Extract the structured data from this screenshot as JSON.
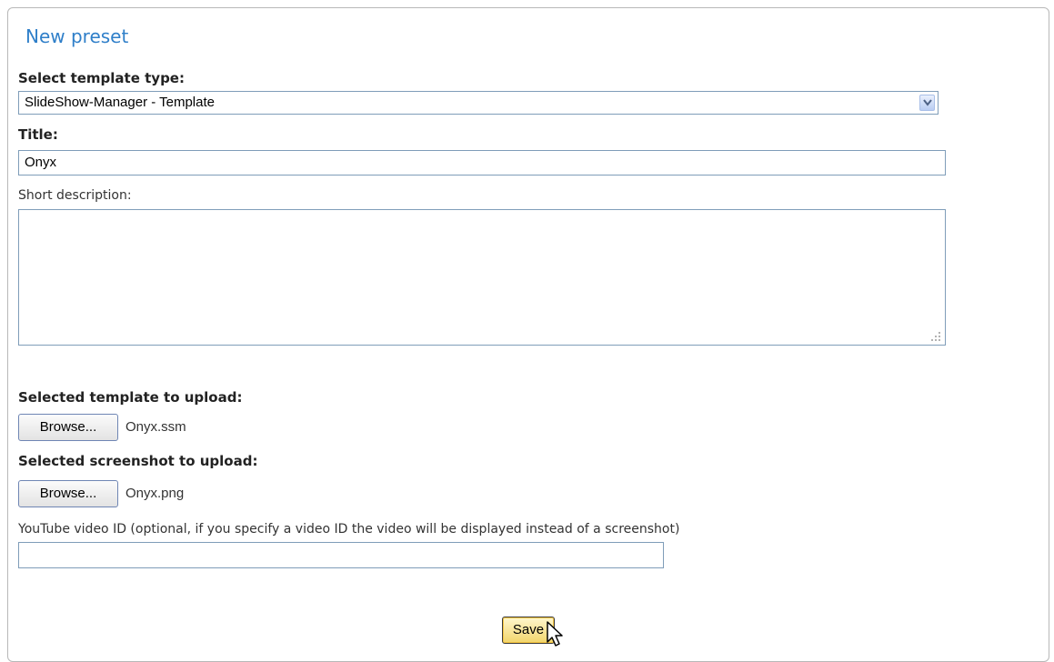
{
  "panel": {
    "heading": "New preset"
  },
  "template_type": {
    "label": "Select template type:",
    "selected": "SlideShow-Manager - Template"
  },
  "title_field": {
    "label": "Title:",
    "value": "Onyx"
  },
  "description_field": {
    "label": "Short description:",
    "value": ""
  },
  "template_upload": {
    "label": "Selected template to upload:",
    "button_label": "Browse...",
    "file_name": "Onyx.ssm"
  },
  "screenshot_upload": {
    "label": "Selected screenshot to upload:",
    "button_label": "Browse...",
    "file_name": "Onyx.png"
  },
  "youtube_field": {
    "label": "YouTube video ID (optional, if you specify a video ID the video will be displayed instead of a screenshot)",
    "value": ""
  },
  "actions": {
    "save_label": "Save"
  },
  "icons": {
    "dropdown": "chevron-down-icon",
    "resize": "resize-grip-icon",
    "cursor": "mouse-pointer-icon"
  },
  "colors": {
    "heading": "#2f7fc9",
    "input_border": "#7f9db9",
    "save_button": "#f2d56a"
  }
}
